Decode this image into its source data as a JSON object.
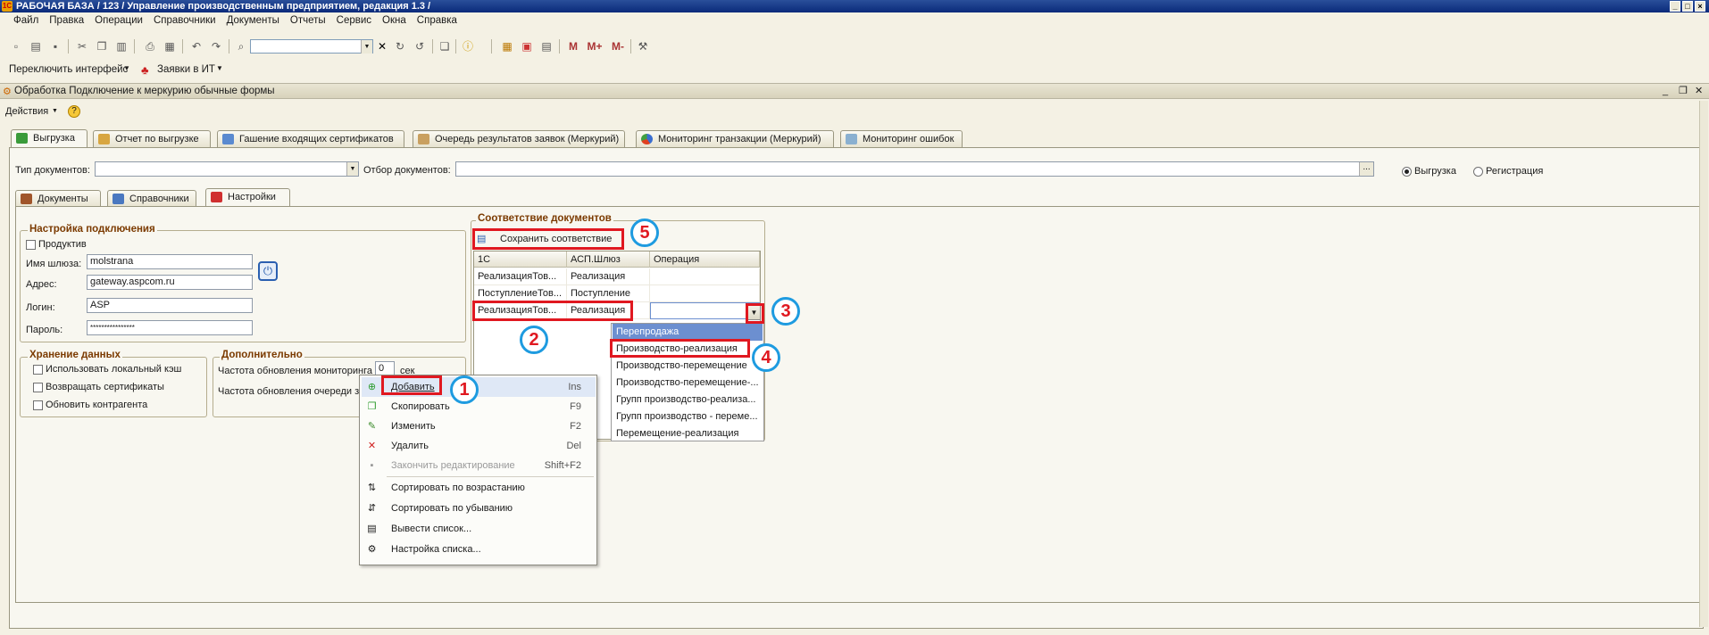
{
  "window": {
    "title": "РАБОЧАЯ БАЗА / 123 /  Управление производственным предприятием, редакция 1.3 /"
  },
  "menu": [
    "Файл",
    "Правка",
    "Операции",
    "Справочники",
    "Документы",
    "Отчеты",
    "Сервис",
    "Окна",
    "Справка"
  ],
  "toolbar2": {
    "switch_interface": "Переключить интерфейс",
    "requests_it": "Заявки в ИТ"
  },
  "doc_window": {
    "title": "Обработка  Подключение к меркурию обычные формы",
    "actions": "Действия"
  },
  "main_tabs": [
    "Выгрузка",
    "Отчет по выгрузке",
    "Гашение входящих сертификатов",
    "Очередь результатов заявок (Меркурий)",
    "Мониторинг транзакции (Меркурий)",
    "Мониторинг ошибок"
  ],
  "filters": {
    "doc_type_label": "Тип документов:",
    "doc_filter_label": "Отбор документов:",
    "radio_upload": "Выгрузка",
    "radio_register": "Регистрация",
    "filter_btn": "..."
  },
  "sub_tabs": [
    "Документы",
    "Справочники",
    "Настройки"
  ],
  "connection": {
    "title": "Настройка подключения",
    "productive": "Продуктив",
    "gateway_label": "Имя шлюза:",
    "gateway_value": "molstrana",
    "address_label": "Адрес:",
    "address_value": "gateway.aspcom.ru",
    "login_label": "Логин:",
    "login_value": "ASP",
    "password_label": "Пароль:",
    "password_value": "****************"
  },
  "storage": {
    "title": "Хранение данных",
    "opt1": "Использовать локальный кэш",
    "opt2": "Возвращать сертификаты",
    "opt3": "Обновить контрагента"
  },
  "additional": {
    "title": "Дополнительно",
    "freq_monitor": "Частота обновления мониторинга",
    "freq_value": "0",
    "unit": "сек",
    "freq_queue": "Частота обновления очереди за"
  },
  "mapping": {
    "title": "Соответствие документов",
    "save_button": "Сохранить соответствие",
    "columns": [
      "1С",
      "АСП.Шлюз",
      "Операция"
    ],
    "rows": [
      [
        "РеализацияТов...",
        "Реализация",
        ""
      ],
      [
        "ПоступлениеТов...",
        "Поступление",
        ""
      ],
      [
        "РеализацияТов...",
        "Реализация",
        ""
      ]
    ]
  },
  "dropdown_options": [
    "Перепродажа",
    "Производство-реализация",
    "Производство-перемещение",
    "Производство-перемещение-...",
    "Групп производство-реализа...",
    "Групп производство - переме...",
    "Перемещение-реализация"
  ],
  "context_menu": [
    {
      "label": "Добавить",
      "shortcut": "Ins",
      "icon": "add-icon"
    },
    {
      "label": "Скопировать",
      "shortcut": "F9",
      "icon": "copy-icon"
    },
    {
      "label": "Изменить",
      "shortcut": "F2",
      "icon": "edit-icon"
    },
    {
      "label": "Удалить",
      "shortcut": "Del",
      "icon": "delete-icon"
    },
    {
      "label": "Закончить редактирование",
      "shortcut": "Shift+F2",
      "icon": "end-edit-icon"
    },
    {
      "label": "Сортировать по возрастанию",
      "shortcut": "",
      "icon": "sort-asc-icon"
    },
    {
      "label": "Сортировать по убыванию",
      "shortcut": "",
      "icon": "sort-desc-icon"
    },
    {
      "label": "Вывести список...",
      "shortcut": "",
      "icon": "print-list-icon"
    },
    {
      "label": "Настройка списка...",
      "shortcut": "",
      "icon": "list-settings-icon"
    }
  ],
  "annotations": [
    "1",
    "2",
    "3",
    "4",
    "5"
  ],
  "colors": {
    "highlight": "#e01820",
    "callout": "#1e9be0",
    "selection": "#6c8fd0"
  }
}
